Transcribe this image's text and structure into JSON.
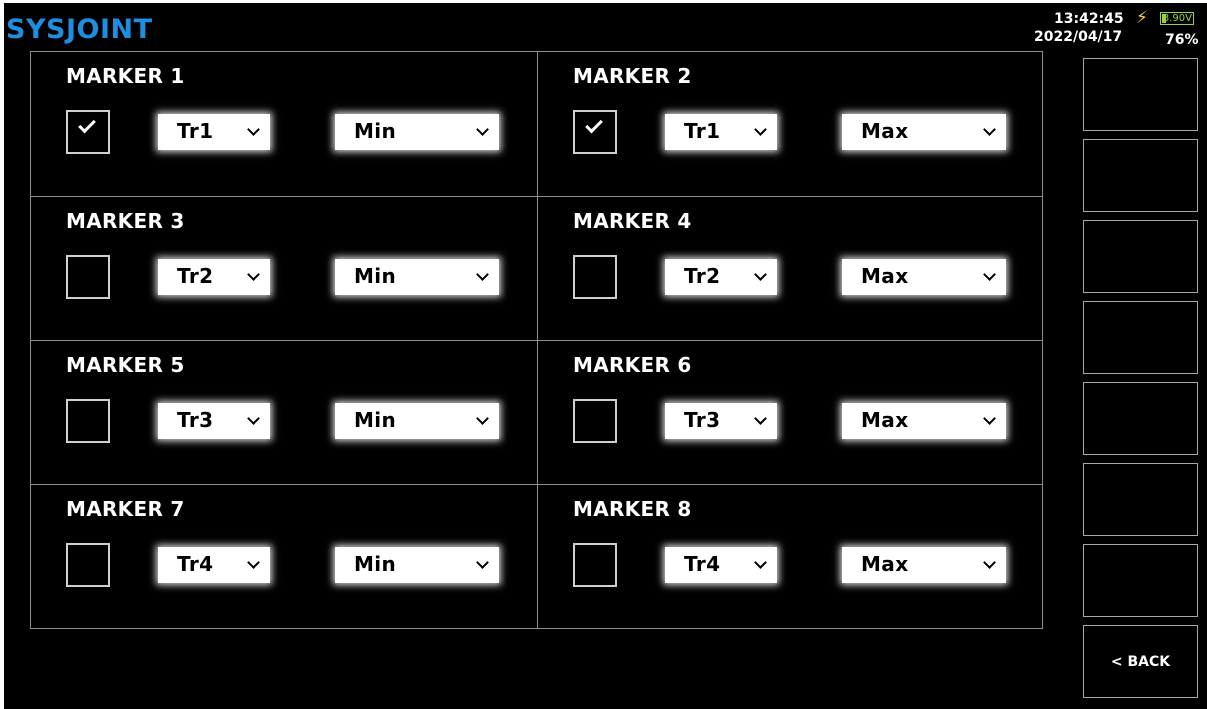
{
  "header": {
    "logo": "SYSJOINT",
    "time": "13:42:45",
    "date": "2022/04/17",
    "battery_voltage": "3.90V",
    "battery_percent": "76%",
    "charging_icon": "lightning-bolt-icon"
  },
  "markers": [
    {
      "title": "MARKER 1",
      "enabled": true,
      "trace": "Tr1",
      "mode": "Min"
    },
    {
      "title": "MARKER 2",
      "enabled": true,
      "trace": "Tr1",
      "mode": "Max"
    },
    {
      "title": "MARKER 3",
      "enabled": false,
      "trace": "Tr2",
      "mode": "Min"
    },
    {
      "title": "MARKER 4",
      "enabled": false,
      "trace": "Tr2",
      "mode": "Max"
    },
    {
      "title": "MARKER 5",
      "enabled": false,
      "trace": "Tr3",
      "mode": "Min"
    },
    {
      "title": "MARKER 6",
      "enabled": false,
      "trace": "Tr3",
      "mode": "Max"
    },
    {
      "title": "MARKER 7",
      "enabled": false,
      "trace": "Tr4",
      "mode": "Min"
    },
    {
      "title": "MARKER 8",
      "enabled": false,
      "trace": "Tr4",
      "mode": "Max"
    }
  ],
  "softkeys": [
    "",
    "",
    "",
    "",
    "",
    "",
    "",
    "< BACK"
  ],
  "colors": {
    "background": "#000000",
    "logo": "#1e8ee0",
    "battery": "#9ad33a",
    "charging": "#f0cf3a",
    "grid_line": "#8e8e8e"
  }
}
